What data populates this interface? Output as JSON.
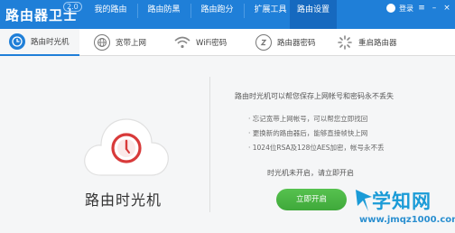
{
  "app": {
    "title": "路由器卫士",
    "version": "2.0"
  },
  "nav": {
    "tabs": [
      {
        "label": "我的路由"
      },
      {
        "label": "路由防黑"
      },
      {
        "label": "路由跑分"
      },
      {
        "label": "扩展工具"
      },
      {
        "label": "路由设置"
      }
    ],
    "active_index": 4,
    "login_label": "登录"
  },
  "subtabs": [
    {
      "label": "路由时光机",
      "icon": "clock-icon"
    },
    {
      "label": "宽带上网",
      "icon": "globe-icon"
    },
    {
      "label": "WiFi密码",
      "icon": "wifi-icon"
    },
    {
      "label": "路由器密码",
      "icon": "router-password-icon"
    },
    {
      "label": "重启路由器",
      "icon": "restart-icon"
    }
  ],
  "feature": {
    "title": "路由时光机"
  },
  "content": {
    "description": "路由时光机可以帮您保存上网帐号和密码永不丢失",
    "bullets": [
      "· 忘记宽带上网帐号，可以帮您立即找回",
      "· 更换新的路由器后，能够直接帧快上网",
      "· 1024位RSA及128位AES加密，帐号永不丢"
    ],
    "status": "时光机未开启，请立即开启",
    "button_label": "立即开启"
  },
  "watermark": {
    "text": "学知网",
    "url": "www.jmqz1000.com"
  },
  "colors": {
    "brand": "#1f7fd8",
    "active_tab": "#1669bf",
    "button": "#4cb845",
    "icon_red": "#d83a3a"
  }
}
